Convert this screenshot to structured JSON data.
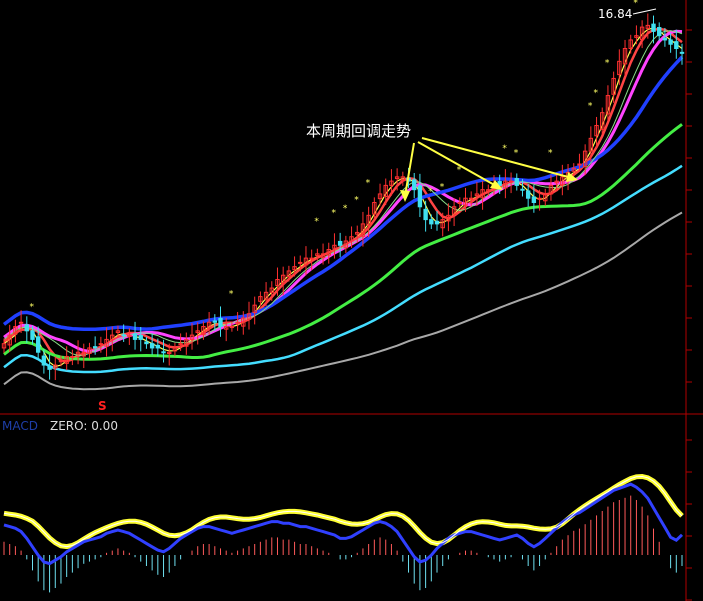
{
  "chart_data": {
    "type": "candlestick",
    "annotation": "本周期回调走势",
    "peak_label": "16.84",
    "indicator_label": "ZERO: 0.00",
    "indicator_label_prefix": "MACD",
    "signal_marker": "S",
    "x": [
      0,
      1,
      2,
      3,
      4,
      5,
      6,
      7,
      8,
      9,
      10,
      11,
      12,
      13,
      14,
      15,
      16,
      17,
      18,
      19,
      20,
      21,
      22,
      23,
      24,
      25,
      26,
      27,
      28,
      29,
      30,
      31,
      32,
      33,
      34,
      35,
      36,
      37,
      38,
      39,
      40,
      41,
      42,
      43,
      44,
      45,
      46,
      47,
      48,
      49,
      50,
      51,
      52,
      53,
      54,
      55,
      56,
      57,
      58,
      59,
      60,
      61,
      62,
      63,
      64,
      65,
      66,
      67,
      68,
      69,
      70,
      71,
      72,
      73,
      74,
      75,
      76,
      77,
      78,
      79,
      80,
      81,
      82,
      83,
      84,
      85,
      86,
      87,
      88,
      89,
      90,
      91,
      92,
      93,
      94,
      95,
      96,
      97,
      98,
      99,
      100,
      101,
      102,
      103,
      104,
      105,
      106,
      107,
      108,
      109,
      110,
      111,
      112,
      113,
      114,
      115,
      116,
      117,
      118,
      119
    ],
    "close": [
      9.4,
      9.6,
      9.8,
      9.9,
      9.7,
      9.5,
      9.2,
      8.9,
      8.8,
      8.9,
      9.0,
      9.1,
      9.1,
      9.2,
      9.2,
      9.3,
      9.3,
      9.4,
      9.5,
      9.6,
      9.7,
      9.6,
      9.6,
      9.5,
      9.5,
      9.4,
      9.3,
      9.3,
      9.2,
      9.2,
      9.3,
      9.4,
      9.5,
      9.6,
      9.7,
      9.8,
      9.9,
      9.9,
      9.8,
      9.8,
      9.8,
      9.9,
      10.0,
      10.1,
      10.3,
      10.5,
      10.6,
      10.7,
      10.9,
      11.0,
      11.1,
      11.2,
      11.3,
      11.4,
      11.4,
      11.5,
      11.5,
      11.6,
      11.7,
      11.7,
      11.8,
      11.9,
      12.0,
      12.2,
      12.4,
      12.7,
      12.9,
      13.1,
      13.2,
      13.3,
      13.3,
      13.2,
      13.0,
      12.6,
      12.3,
      12.2,
      12.2,
      12.3,
      12.4,
      12.6,
      12.7,
      12.8,
      12.8,
      12.9,
      13.0,
      13.0,
      13.1,
      13.1,
      13.2,
      13.2,
      13.1,
      13.0,
      12.8,
      12.7,
      12.8,
      12.9,
      13.1,
      13.2,
      13.3,
      13.4,
      13.5,
      13.6,
      13.9,
      14.2,
      14.5,
      14.8,
      15.2,
      15.6,
      16.0,
      16.3,
      16.5,
      16.6,
      16.8,
      16.84,
      16.7,
      16.6,
      16.5,
      16.4,
      16.3,
      16.2
    ],
    "macd_hist": [
      0.06,
      0.05,
      0.04,
      0.02,
      -0.02,
      -0.07,
      -0.12,
      -0.16,
      -0.17,
      -0.15,
      -0.13,
      -0.1,
      -0.08,
      -0.06,
      -0.04,
      -0.03,
      -0.02,
      -0.01,
      0.01,
      0.02,
      0.03,
      0.02,
      0.01,
      -0.01,
      -0.03,
      -0.05,
      -0.07,
      -0.09,
      -0.1,
      -0.08,
      -0.05,
      -0.02,
      0.0,
      0.02,
      0.04,
      0.05,
      0.05,
      0.04,
      0.03,
      0.02,
      0.01,
      0.02,
      0.03,
      0.04,
      0.05,
      0.06,
      0.07,
      0.08,
      0.08,
      0.07,
      0.07,
      0.06,
      0.05,
      0.05,
      0.04,
      0.03,
      0.02,
      0.01,
      0.0,
      -0.02,
      -0.02,
      -0.01,
      0.01,
      0.03,
      0.05,
      0.07,
      0.08,
      0.07,
      0.05,
      0.02,
      -0.03,
      -0.08,
      -0.13,
      -0.16,
      -0.15,
      -0.12,
      -0.08,
      -0.05,
      -0.02,
      0.0,
      0.01,
      0.02,
      0.02,
      0.01,
      0.0,
      -0.01,
      -0.02,
      -0.03,
      -0.02,
      -0.01,
      0.0,
      -0.02,
      -0.05,
      -0.07,
      -0.05,
      -0.02,
      0.01,
      0.04,
      0.07,
      0.09,
      0.11,
      0.12,
      0.14,
      0.16,
      0.18,
      0.2,
      0.22,
      0.24,
      0.25,
      0.26,
      0.27,
      0.25,
      0.22,
      0.18,
      0.12,
      0.06,
      0.0,
      -0.06,
      -0.08,
      -0.05
    ],
    "moving_average_colors": [
      "#ffff55",
      "#ff4444",
      "#ff44ff",
      "#2040ff",
      "#44ee44",
      "#44ddff",
      "#a8a8a8",
      "#88dd88"
    ],
    "up_color": "#ff3030",
    "down_color": "#40e0f0",
    "ylim": [
      8.2,
      17.2
    ]
  }
}
